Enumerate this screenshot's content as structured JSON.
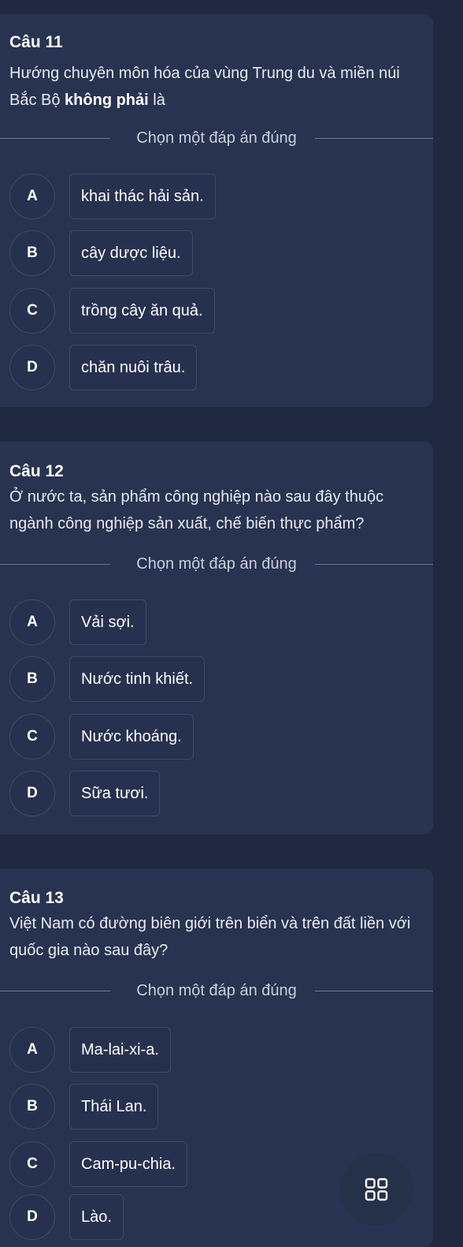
{
  "questions": [
    {
      "number": "Câu 11",
      "text_before": "Hướng chuyên môn hóa của vùng Trung du và miền núi Bắc Bộ ",
      "text_bold": "không phải",
      "text_after": " là",
      "prompt": "Chọn một đáp án đúng",
      "options": [
        {
          "letter": "A",
          "text": "khai thác hải sản."
        },
        {
          "letter": "B",
          "text": "cây dược liệu."
        },
        {
          "letter": "C",
          "text": "trồng cây ăn quả."
        },
        {
          "letter": "D",
          "text": "chăn nuôi trâu."
        }
      ]
    },
    {
      "number": "Câu 12",
      "text_before": "Ở nước ta, sản phẩm công nghiệp nào sau đây thuộc ngành công nghiệp sản xuất, chế biến thực phẩm?",
      "text_bold": "",
      "text_after": "",
      "prompt": "Chọn một đáp án đúng",
      "options": [
        {
          "letter": "A",
          "text": "Vải sợi."
        },
        {
          "letter": "B",
          "text": "Nước tinh khiết."
        },
        {
          "letter": "C",
          "text": "Nước khoáng."
        },
        {
          "letter": "D",
          "text": "Sữa tươi."
        }
      ]
    },
    {
      "number": "Câu 13",
      "text_before": "Việt Nam có đường biên giới trên biển và trên đất liền với quốc gia nào sau đây?",
      "text_bold": "",
      "text_after": "",
      "prompt": "Chọn một đáp án đúng",
      "options": [
        {
          "letter": "A",
          "text": "Ma-lai-xi-a."
        },
        {
          "letter": "B",
          "text": "Thái Lan."
        },
        {
          "letter": "C",
          "text": "Cam-pu-chia."
        },
        {
          "letter": "D",
          "text": "Lào."
        }
      ]
    }
  ],
  "fab_icon": "grid-icon",
  "colors": {
    "background": "#1f2a40",
    "card": "#273350",
    "border": "#3e4a66"
  }
}
